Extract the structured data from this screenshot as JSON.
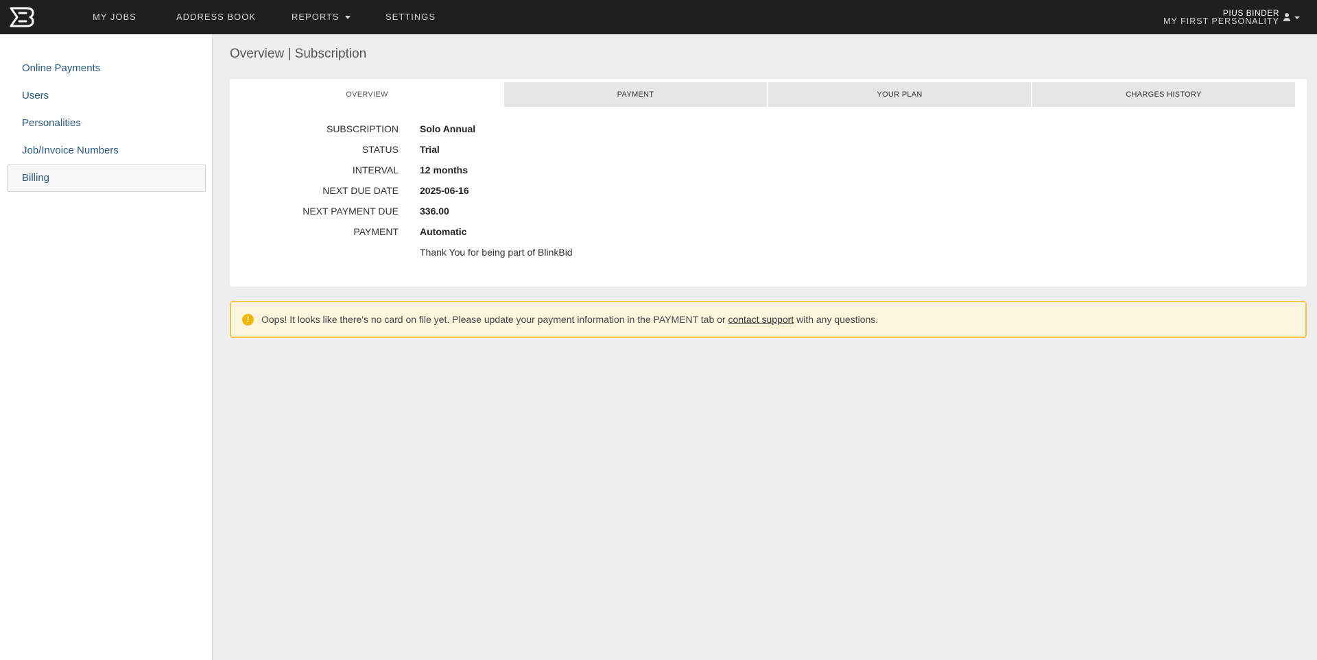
{
  "nav": {
    "logo": "B",
    "items": [
      {
        "label": "MY JOBS"
      },
      {
        "label": "ADDRESS BOOK"
      },
      {
        "label": "REPORTS"
      },
      {
        "label": "SETTINGS"
      }
    ],
    "user_name": "PIUS BINDER",
    "user_personality": "MY FIRST PERSONALITY"
  },
  "sidebar": {
    "items": [
      {
        "label": "Online Payments"
      },
      {
        "label": "Users"
      },
      {
        "label": "Personalities"
      },
      {
        "label": "Job/Invoice Numbers"
      },
      {
        "label": "Billing",
        "active": true
      }
    ]
  },
  "page": {
    "title": "Overview | Subscription"
  },
  "tabs": [
    {
      "label": "OVERVIEW",
      "active": true
    },
    {
      "label": "PAYMENT"
    },
    {
      "label": "YOUR PLAN"
    },
    {
      "label": "CHARGES HISTORY"
    }
  ],
  "overview": {
    "rows": [
      {
        "label": "SUBSCRIPTION",
        "value": "Solo Annual"
      },
      {
        "label": "STATUS",
        "value": "Trial"
      },
      {
        "label": "INTERVAL",
        "value": "12 months"
      },
      {
        "label": "NEXT DUE DATE",
        "value": "2025-06-16"
      },
      {
        "label": "NEXT PAYMENT DUE",
        "value": "336.00"
      },
      {
        "label": "PAYMENT",
        "value": "Automatic"
      }
    ],
    "thanks": "Thank You for being part of BlinkBid"
  },
  "alert": {
    "icon": "!",
    "text_before": "Oops! It looks like there's no card on file yet. Please update your payment information in the PAYMENT tab or ",
    "link": "contact support",
    "text_after": " with any questions."
  },
  "colors": {
    "topbar": "#1f1f20",
    "sidebar_link": "#2a5885",
    "alert_bg": "#fdf5de",
    "alert_border": "#f2c94c"
  }
}
